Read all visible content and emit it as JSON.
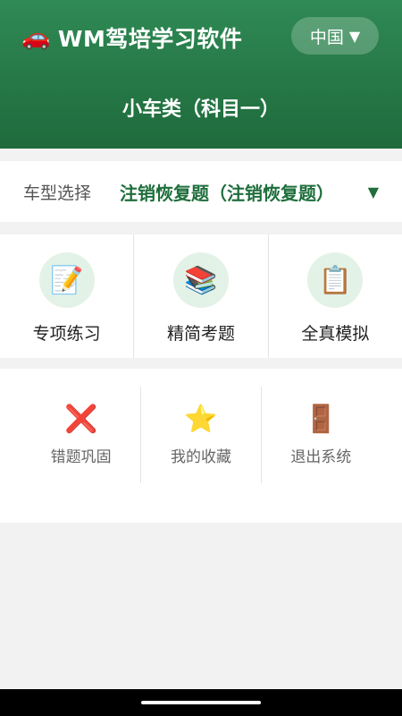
{
  "header": {
    "car_icon": "🚗",
    "app_title": "WM驾培学习软件",
    "region_label": "中国",
    "region_arrow": "▼",
    "subject_title": "小车类（科目一）"
  },
  "vehicle_select": {
    "label": "车型选择",
    "value": "注销恢复题（注销恢复题）",
    "dropdown_arrow": "▼"
  },
  "main_menu": [
    {
      "icon": "📝",
      "icon_name": "memo-icon",
      "label": "专项练习"
    },
    {
      "icon": "📚",
      "icon_name": "books-icon",
      "label": "精简考题"
    },
    {
      "icon": "📋",
      "icon_name": "clipboard-icon",
      "label": "全真模拟"
    }
  ],
  "secondary_menu": [
    {
      "icon": "❌",
      "icon_name": "cross-icon",
      "label": "错题巩固"
    },
    {
      "icon": "⭐",
      "icon_name": "star-icon",
      "label": "我的收藏"
    },
    {
      "icon": "🚪",
      "icon_name": "door-icon",
      "label": "退出系统"
    }
  ],
  "colors": {
    "header_green": "#2f8a54",
    "accent_green": "#1f6e3c",
    "icon_circle": "#e3f2e7"
  }
}
